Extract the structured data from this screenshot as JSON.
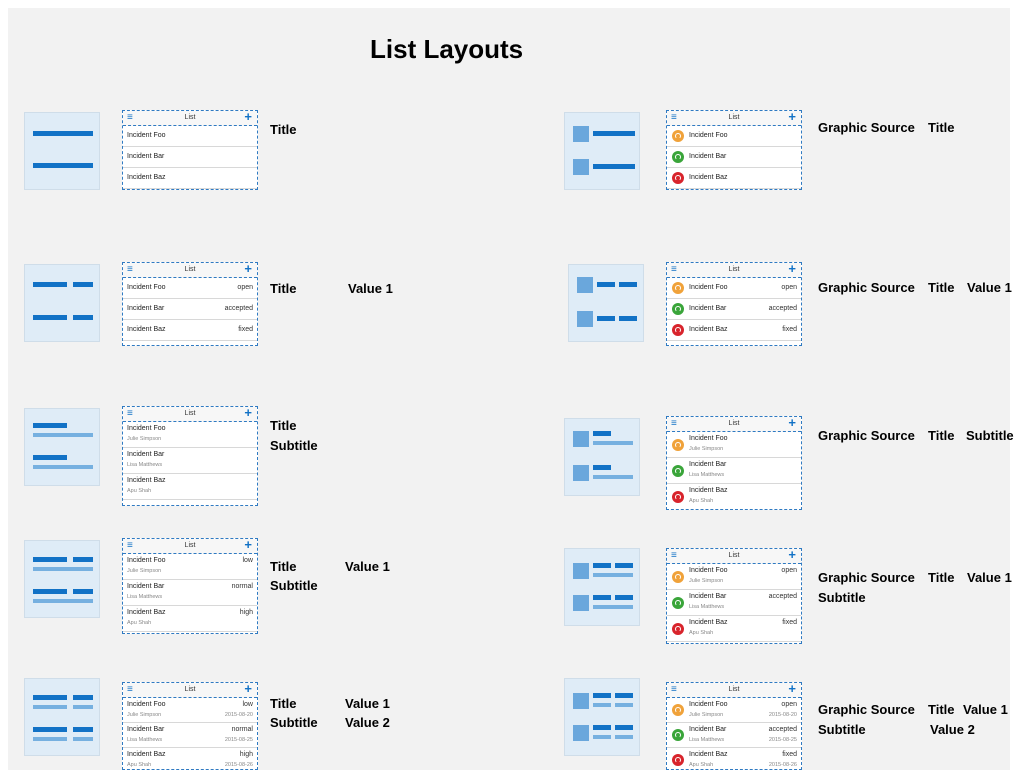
{
  "page_title": "List Layouts",
  "colors": {
    "accent": "#1272c6",
    "light_accent": "#76b0e0",
    "icon_orange": "#f0a23a",
    "icon_green": "#3aa53a",
    "icon_red": "#d8242c"
  },
  "list_header": {
    "title": "List",
    "menu_icon": "hamburger-icon",
    "add_icon": "plus-icon"
  },
  "items": {
    "titles": [
      "Incident Foo",
      "Incident Bar",
      "Incident Baz"
    ],
    "subtitles": [
      "Julie Simpson",
      "Lisa Matthews",
      "Apu Shah"
    ],
    "values_left": [
      "low",
      "normal",
      "high"
    ],
    "values_right": [
      "open",
      "accepted",
      "fixed"
    ],
    "dates": [
      "2015-08-20",
      "2015-08-25",
      "2015-08-26"
    ]
  },
  "labels": {
    "title": "Title",
    "subtitle": "Subtitle",
    "value1": "Value 1",
    "value2": "Value 2",
    "graphic_source": "Graphic Source"
  }
}
